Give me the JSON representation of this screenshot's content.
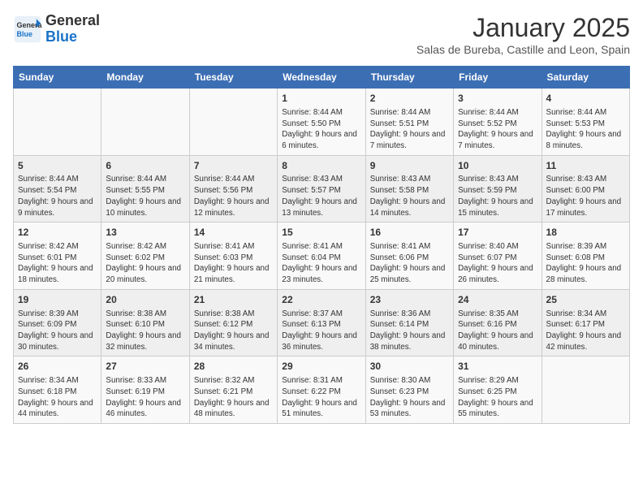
{
  "logo": {
    "line1": "General",
    "line2": "Blue"
  },
  "title": "January 2025",
  "subtitle": "Salas de Bureba, Castille and Leon, Spain",
  "weekdays": [
    "Sunday",
    "Monday",
    "Tuesday",
    "Wednesday",
    "Thursday",
    "Friday",
    "Saturday"
  ],
  "weeks": [
    [
      {
        "day": "",
        "info": ""
      },
      {
        "day": "",
        "info": ""
      },
      {
        "day": "",
        "info": ""
      },
      {
        "day": "1",
        "info": "Sunrise: 8:44 AM\nSunset: 5:50 PM\nDaylight: 9 hours and 6 minutes."
      },
      {
        "day": "2",
        "info": "Sunrise: 8:44 AM\nSunset: 5:51 PM\nDaylight: 9 hours and 7 minutes."
      },
      {
        "day": "3",
        "info": "Sunrise: 8:44 AM\nSunset: 5:52 PM\nDaylight: 9 hours and 7 minutes."
      },
      {
        "day": "4",
        "info": "Sunrise: 8:44 AM\nSunset: 5:53 PM\nDaylight: 9 hours and 8 minutes."
      }
    ],
    [
      {
        "day": "5",
        "info": "Sunrise: 8:44 AM\nSunset: 5:54 PM\nDaylight: 9 hours and 9 minutes."
      },
      {
        "day": "6",
        "info": "Sunrise: 8:44 AM\nSunset: 5:55 PM\nDaylight: 9 hours and 10 minutes."
      },
      {
        "day": "7",
        "info": "Sunrise: 8:44 AM\nSunset: 5:56 PM\nDaylight: 9 hours and 12 minutes."
      },
      {
        "day": "8",
        "info": "Sunrise: 8:43 AM\nSunset: 5:57 PM\nDaylight: 9 hours and 13 minutes."
      },
      {
        "day": "9",
        "info": "Sunrise: 8:43 AM\nSunset: 5:58 PM\nDaylight: 9 hours and 14 minutes."
      },
      {
        "day": "10",
        "info": "Sunrise: 8:43 AM\nSunset: 5:59 PM\nDaylight: 9 hours and 15 minutes."
      },
      {
        "day": "11",
        "info": "Sunrise: 8:43 AM\nSunset: 6:00 PM\nDaylight: 9 hours and 17 minutes."
      }
    ],
    [
      {
        "day": "12",
        "info": "Sunrise: 8:42 AM\nSunset: 6:01 PM\nDaylight: 9 hours and 18 minutes."
      },
      {
        "day": "13",
        "info": "Sunrise: 8:42 AM\nSunset: 6:02 PM\nDaylight: 9 hours and 20 minutes."
      },
      {
        "day": "14",
        "info": "Sunrise: 8:41 AM\nSunset: 6:03 PM\nDaylight: 9 hours and 21 minutes."
      },
      {
        "day": "15",
        "info": "Sunrise: 8:41 AM\nSunset: 6:04 PM\nDaylight: 9 hours and 23 minutes."
      },
      {
        "day": "16",
        "info": "Sunrise: 8:41 AM\nSunset: 6:06 PM\nDaylight: 9 hours and 25 minutes."
      },
      {
        "day": "17",
        "info": "Sunrise: 8:40 AM\nSunset: 6:07 PM\nDaylight: 9 hours and 26 minutes."
      },
      {
        "day": "18",
        "info": "Sunrise: 8:39 AM\nSunset: 6:08 PM\nDaylight: 9 hours and 28 minutes."
      }
    ],
    [
      {
        "day": "19",
        "info": "Sunrise: 8:39 AM\nSunset: 6:09 PM\nDaylight: 9 hours and 30 minutes."
      },
      {
        "day": "20",
        "info": "Sunrise: 8:38 AM\nSunset: 6:10 PM\nDaylight: 9 hours and 32 minutes."
      },
      {
        "day": "21",
        "info": "Sunrise: 8:38 AM\nSunset: 6:12 PM\nDaylight: 9 hours and 34 minutes."
      },
      {
        "day": "22",
        "info": "Sunrise: 8:37 AM\nSunset: 6:13 PM\nDaylight: 9 hours and 36 minutes."
      },
      {
        "day": "23",
        "info": "Sunrise: 8:36 AM\nSunset: 6:14 PM\nDaylight: 9 hours and 38 minutes."
      },
      {
        "day": "24",
        "info": "Sunrise: 8:35 AM\nSunset: 6:16 PM\nDaylight: 9 hours and 40 minutes."
      },
      {
        "day": "25",
        "info": "Sunrise: 8:34 AM\nSunset: 6:17 PM\nDaylight: 9 hours and 42 minutes."
      }
    ],
    [
      {
        "day": "26",
        "info": "Sunrise: 8:34 AM\nSunset: 6:18 PM\nDaylight: 9 hours and 44 minutes."
      },
      {
        "day": "27",
        "info": "Sunrise: 8:33 AM\nSunset: 6:19 PM\nDaylight: 9 hours and 46 minutes."
      },
      {
        "day": "28",
        "info": "Sunrise: 8:32 AM\nSunset: 6:21 PM\nDaylight: 9 hours and 48 minutes."
      },
      {
        "day": "29",
        "info": "Sunrise: 8:31 AM\nSunset: 6:22 PM\nDaylight: 9 hours and 51 minutes."
      },
      {
        "day": "30",
        "info": "Sunrise: 8:30 AM\nSunset: 6:23 PM\nDaylight: 9 hours and 53 minutes."
      },
      {
        "day": "31",
        "info": "Sunrise: 8:29 AM\nSunset: 6:25 PM\nDaylight: 9 hours and 55 minutes."
      },
      {
        "day": "",
        "info": ""
      }
    ]
  ]
}
